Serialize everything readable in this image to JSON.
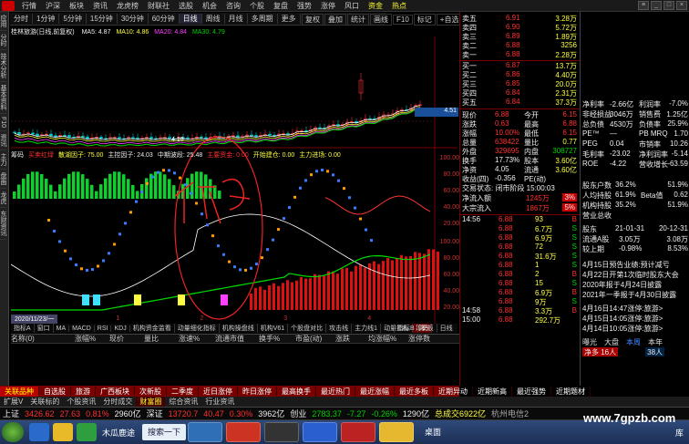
{
  "menubar": {
    "items": [
      "行情",
      "沪深",
      "板块",
      "资讯",
      "龙虎榜",
      "财联社",
      "选股",
      "机会",
      "咨询",
      "个股",
      "复盘",
      "强势",
      "涨停",
      "风口",
      "资金",
      "热点"
    ],
    "highlighted": [
      14,
      15
    ],
    "window_buttons": [
      "≡",
      "_",
      "□",
      "×"
    ]
  },
  "sidebar": {
    "items": [
      "应用",
      "分时",
      "技术分析",
      "基本资料",
      "F10",
      "资讯",
      "主力",
      "盘面",
      "龙虎",
      "东财资讯"
    ]
  },
  "toolbar": {
    "items": [
      "分时",
      "1分钟",
      "5分钟",
      "15分钟",
      "30分钟",
      "60分钟",
      "日线",
      "周线",
      "月线",
      "多周期",
      "更多"
    ],
    "selected": 6,
    "right_items": [
      "复权",
      "叠加",
      "统计",
      "画线",
      "F10",
      "标记",
      "+自选",
      "返回"
    ]
  },
  "stock": {
    "name": "桂林旅游(日线,前复权)"
  },
  "ma": {
    "ma5": "MA5: 4.87",
    "ma10": "MA10: 4.86",
    "ma20": "MA20: 4.84",
    "ma30": "MA30: 4.79"
  },
  "price_axis": {
    "top": "5.13",
    "mid": "4.51",
    "low": "4.18"
  },
  "indicator": {
    "name": "筹码",
    "items": [
      "买卖红绿",
      "散湖因子: 75.00",
      "主控因子: 24.03",
      "中期波段: 25.48",
      "主要资金: 0.00",
      "开始建仓: 0.00",
      "主力进场: 0.00"
    ],
    "axis": [
      "100.00",
      "80.00",
      "60.00",
      "40.00",
      "20.00"
    ]
  },
  "lower_axis": [
    "100.00",
    "80.00",
    "60.00",
    "40.00",
    "20.00"
  ],
  "date_bar": {
    "date": "2020/11/23/一",
    "labels": [
      "1",
      "2",
      "3",
      "4"
    ]
  },
  "tabs_lower": [
    "指标A",
    "窗口",
    "MA",
    "MACD",
    "RSI",
    "KDJ",
    "机构资金监看",
    "动量细化指标",
    "机构操盘线",
    "机构V61",
    "个股盘对比",
    "攻击线",
    "主力线1",
    "动量指标",
    "筹码"
  ],
  "tabs_lower_sel": 14,
  "tabs_right": [
    "指标B",
    "模板",
    "日线"
  ],
  "list_header": [
    "名称(0)",
    "涨幅%",
    "现价",
    "量比",
    "涨速%",
    "流通市值",
    "换手%",
    "市盈(动)",
    "涨跌",
    "均涨幅%",
    "涨停数"
  ],
  "quote": {
    "sells": [
      {
        "label": "卖五",
        "price": "6.91",
        "vol": "3.28万"
      },
      {
        "label": "卖四",
        "price": "6.90",
        "vol": "5.72万"
      },
      {
        "label": "卖三",
        "price": "6.89",
        "vol": "1.89万"
      },
      {
        "label": "卖二",
        "price": "6.88",
        "vol": "3256"
      },
      {
        "label": "卖一",
        "price": "6.88",
        "vol": "2.28万"
      }
    ],
    "buys": [
      {
        "label": "买一",
        "price": "6.87",
        "vol": "13.7万"
      },
      {
        "label": "买二",
        "price": "6.86",
        "vol": "4.40万"
      },
      {
        "label": "买三",
        "price": "6.85",
        "vol": "20.0万"
      },
      {
        "label": "买四",
        "price": "6.84",
        "vol": "2.31万"
      },
      {
        "label": "买五",
        "price": "6.84",
        "vol": "37.3万"
      }
    ],
    "stats": [
      {
        "l1": "现价",
        "v1": "6.88",
        "l2": "今开",
        "v2": "6.15"
      },
      {
        "l1": "涨跌",
        "v1": "0.63",
        "l2": "最高",
        "v2": "6.88"
      },
      {
        "l1": "涨幅",
        "v1": "10.00%",
        "l2": "最低",
        "v2": "6.15"
      },
      {
        "l1": "总量",
        "v1": "638422",
        "l2": "量比",
        "v2": "0.77"
      },
      {
        "l1": "外盘",
        "v1": "329695",
        "l2": "内盘",
        "v2": "308727"
      },
      {
        "l1": "换手",
        "v1": "17.73%",
        "l2": "股本",
        "v2": "3.60亿"
      },
      {
        "l1": "净资",
        "v1": "4.05",
        "l2": "流通",
        "v2": "3.60亿"
      },
      {
        "l1": "收益(四)",
        "v1": "-0.356",
        "l2": "PE(动)",
        "v2": ""
      }
    ],
    "trade_status": "交易状态: 闭市阶段 15:00:03",
    "flow": [
      {
        "label": "净流入额",
        "value": "1245万",
        "pct": "3%"
      },
      {
        "label": "大宗流入",
        "value": "1867万",
        "pct": "5%"
      }
    ],
    "ticks": [
      {
        "t": "14:56",
        "p": "6.88",
        "v": "93",
        "s": "B"
      },
      {
        "t": "",
        "p": "6.88",
        "v": "6.7万",
        "s": "S"
      },
      {
        "t": "",
        "p": "6.88",
        "v": "6.9万",
        "s": "S"
      },
      {
        "t": "",
        "p": "6.88",
        "v": "72",
        "s": "S"
      },
      {
        "t": "",
        "p": "6.88",
        "v": "31.6万",
        "s": "S"
      },
      {
        "t": "",
        "p": "6.88",
        "v": "1",
        "s": "S"
      },
      {
        "t": "",
        "p": "6.88",
        "v": "2",
        "s": "B"
      },
      {
        "t": "",
        "p": "6.88",
        "v": "15",
        "s": "S"
      },
      {
        "t": "",
        "p": "6.88",
        "v": "6.9万",
        "s": "B"
      },
      {
        "t": "",
        "p": "6.88",
        "v": "9万",
        "s": "S"
      },
      {
        "t": "14:58",
        "p": "6.88",
        "v": "3.3万",
        "s": "B"
      },
      {
        "t": "15:00",
        "p": "6.88",
        "v": "292.7万",
        "s": ""
      }
    ]
  },
  "fundamentals": {
    "rows": [
      {
        "l": "净利率",
        "v": "-2.66亿",
        "l2": "利润率",
        "v2": "-7.0%"
      },
      {
        "l": "非经损益",
        "v": "3046万",
        "l2": "销售费",
        "v2": "1.25亿"
      },
      {
        "l": "总负债",
        "v": "4530万",
        "l2": "负债率",
        "v2": "25.9%"
      },
      {
        "l": "PE™",
        "v": "—",
        "l2": "PB MRQ",
        "v2": "1.70"
      },
      {
        "l": "PEG",
        "v": "0.04",
        "l2": "市销率",
        "v2": "10.26"
      },
      {
        "l": "毛利率",
        "v": "-23.02",
        "l2": "净利润率",
        "v2": "-5.14"
      },
      {
        "l": "ROE",
        "v": "-4.22",
        "l2": "营收增长",
        "v2": "-63.59"
      }
    ],
    "holders": [
      {
        "l": "股东户数",
        "v": "36.2%",
        "l2": "",
        "v2": "51.9%"
      },
      {
        "l": "人均持股",
        "v": "61.9%",
        "l2": "Beta值",
        "v2": "0.62"
      },
      {
        "l": "机构持股",
        "v": "35.2%",
        "l2": "",
        "v2": "51.9%"
      },
      {
        "l": "营业总收",
        "v": "",
        "l2": "",
        "v2": ""
      }
    ],
    "dates": {
      "l": "股东",
      "v": "21-01-31",
      "v2": "20-12-31"
    },
    "shares": [
      {
        "l": "流通A股",
        "v": "3.05万",
        "v2": "3.08万"
      },
      {
        "l": "较上期",
        "v": "-0.98%",
        "v2": "8.53%"
      }
    ],
    "news": [
      "4月15日预告业绩:预计减亏",
      "4月22日开第1次临时股东大会",
      "2020年报于4月24日披露",
      "2021年一季报于4月30日披露",
      "4月16日14:47涨停:旅游>",
      "4月15日14:05涨停:旅游>",
      "4月14日10:05涨停:旅游>"
    ],
    "bottom_tabs": [
      "曝光",
      "大盘",
      "本周",
      "本年"
    ],
    "bottom_vals": [
      "净多 16人",
      "38人"
    ]
  },
  "section_tabs": [
    "关联品种",
    "自选股",
    "旅游",
    "广西板块",
    "次新股",
    "二季度",
    "近日涨停",
    "昨日涨停",
    "最高换手",
    "最近热门",
    "最近涨幅",
    "最近多板",
    "近期异动",
    "近期新高",
    "最近强势",
    "近期题材"
  ],
  "section_tabs2": [
    "扩展V",
    "关联标的",
    "个股资讯",
    "分时成交",
    "财富圈",
    "综合资讯",
    "行业资讯"
  ],
  "section_tabs2_sel": 4,
  "status_bar": {
    "sh_label": "上证",
    "sh_val": "3426.62",
    "sh_chg": "27.63",
    "sh_pct": "0.81%",
    "sh_amt": "2960亿",
    "sz_label": "深证",
    "sz_val": "13720.7",
    "sz_chg": "40.47",
    "sz_pct": "0.30%",
    "sz_amt": "3962亿",
    "cy_label": "创业",
    "cy_val": "2783.37",
    "cy_chg": "-7.27",
    "cy_pct": "-0.26%",
    "cy_amt": "1290亿",
    "total": "总成交6922亿",
    "region": "杭州电信2"
  },
  "taskbar": {
    "search": "搜索一下",
    "desktop": "桌面",
    "tray": "库",
    "app_title": "木瓜鹿途"
  },
  "watermark": "www.7gpzb.com"
}
